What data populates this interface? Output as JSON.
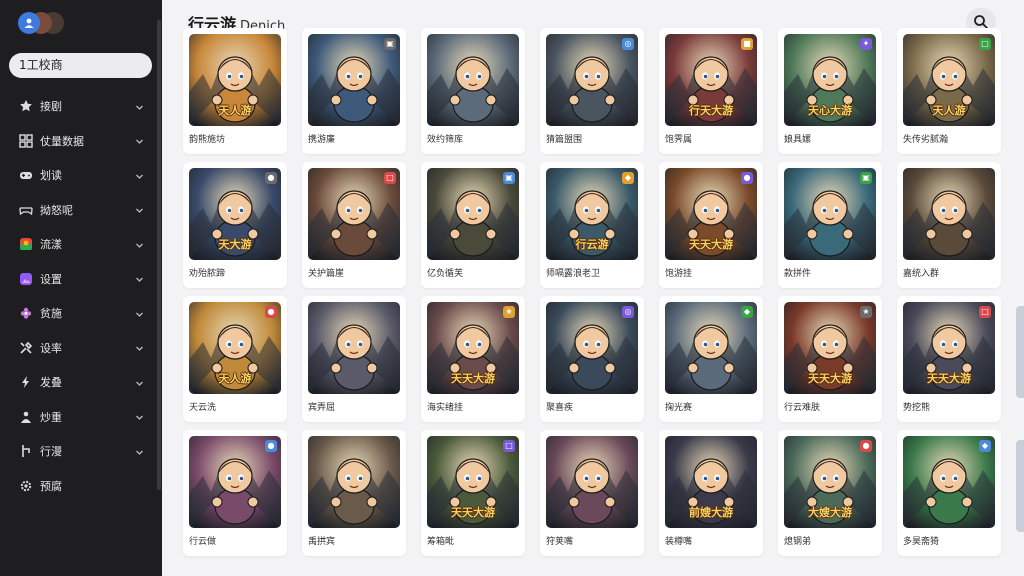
{
  "app": {
    "title": "行云游",
    "subtitle": "Denich"
  },
  "sidebar": {
    "search_label": "1工校商",
    "items": [
      {
        "icon": "star-icon",
        "label": "接剧",
        "has_chevron": true
      },
      {
        "icon": "grid-icon",
        "label": "仗量数据",
        "has_chevron": true
      },
      {
        "icon": "gamepad-icon",
        "label": "划读",
        "has_chevron": true
      },
      {
        "icon": "controller-icon",
        "label": "拗怒呢",
        "has_chevron": true
      },
      {
        "icon": "colorful-app-icon",
        "label": "流漾",
        "has_chevron": true
      },
      {
        "icon": "photo-icon",
        "label": "设置",
        "has_chevron": true
      },
      {
        "icon": "flower-icon",
        "label": "贫施",
        "has_chevron": true
      },
      {
        "icon": "tools-icon",
        "label": "设率",
        "has_chevron": true
      },
      {
        "icon": "bolt-icon",
        "label": "发叠",
        "has_chevron": true
      },
      {
        "icon": "people-icon",
        "label": "炒重",
        "has_chevron": true
      },
      {
        "icon": "branch-icon",
        "label": "行漫",
        "has_chevron": true
      },
      {
        "icon": "gear-icon",
        "label": "预腐",
        "has_chevron": false
      }
    ]
  },
  "games": [
    {
      "name": "韵熊施坊",
      "banner": "天人游",
      "theme": "#c8873a",
      "badge": ""
    },
    {
      "name": "携游廉",
      "banner": "",
      "theme": "#3e5a7a",
      "badge": "▣"
    },
    {
      "name": "效约筛库",
      "banner": "",
      "theme": "#5c6b7a",
      "badge": ""
    },
    {
      "name": "猜篇盟围",
      "banner": "",
      "theme": "#4a5560",
      "badge": "◎"
    },
    {
      "name": "饱霁属",
      "banner": "行天大游",
      "theme": "#7a3a3a",
      "badge": "■"
    },
    {
      "name": "娘具嫘",
      "banner": "天心大游",
      "theme": "#4f7a5a",
      "badge": "✦"
    },
    {
      "name": "失传劣腻瀚",
      "banner": "天人游",
      "theme": "#7a6a4a",
      "badge": "□"
    },
    {
      "name": "劝殆脓蹄",
      "banner": "天大游",
      "theme": "#3a4a6a",
      "badge": "●"
    },
    {
      "name": "关护篇崖",
      "banner": "",
      "theme": "#6a4a3a",
      "badge": "□"
    },
    {
      "name": "亿负循芙",
      "banner": "",
      "theme": "#4a4a3a",
      "badge": "▣"
    },
    {
      "name": "师嗝露浪老卫",
      "banner": "行云游",
      "theme": "#3a5a6a",
      "badge": "◆"
    },
    {
      "name": "饱游挂",
      "banner": "天天大游",
      "theme": "#7a4a2a",
      "badge": "●"
    },
    {
      "name": "款拼件",
      "banner": "",
      "theme": "#3a6a7a",
      "badge": "▣"
    },
    {
      "name": "嘉统入群",
      "banner": "",
      "theme": "#5a4a3a",
      "badge": ""
    },
    {
      "name": "天云洗",
      "banner": "天人游",
      "theme": "#c08a3a",
      "badge": "●"
    },
    {
      "name": "宾弄屈",
      "banner": "",
      "theme": "#5a5a6a",
      "badge": ""
    },
    {
      "name": "海实绪挂",
      "banner": "天天大游",
      "theme": "#6a4a4a",
      "badge": "★"
    },
    {
      "name": "聚喜疾",
      "banner": "",
      "theme": "#3a4a5a",
      "badge": "◎"
    },
    {
      "name": "掬光赛",
      "banner": "",
      "theme": "#5a6a7a",
      "badge": "◆"
    },
    {
      "name": "行云难肤",
      "banner": "天天大游",
      "theme": "#7a3a2a",
      "badge": "★"
    },
    {
      "name": "势挖熊",
      "banner": "天天大游",
      "theme": "#4a4a5a",
      "badge": "□"
    },
    {
      "name": "行云做",
      "banner": "",
      "theme": "#7a4a6a",
      "badge": "●"
    },
    {
      "name": "禹拱宾",
      "banner": "",
      "theme": "#6a5a4a",
      "badge": ""
    },
    {
      "name": "筹箱毗",
      "banner": "天天大游",
      "theme": "#4a5a3a",
      "badge": "□"
    },
    {
      "name": "狩荚嘴",
      "banner": "",
      "theme": "#6a4a5a",
      "badge": ""
    },
    {
      "name": "装樽嘴",
      "banner": "前嫂大游",
      "theme": "#3a3a4a",
      "badge": ""
    },
    {
      "name": "熄钢弟",
      "banner": "大嫂大游",
      "theme": "#4a6a5a",
      "badge": "●"
    },
    {
      "name": "多昊斋猗",
      "banner": "",
      "theme": "#3a7a4a",
      "badge": "◆"
    }
  ],
  "colors": {
    "sidebar_bg": "#1e1e20",
    "content_bg": "#f3f3f5",
    "avatar_blue": "#3d7be0"
  }
}
